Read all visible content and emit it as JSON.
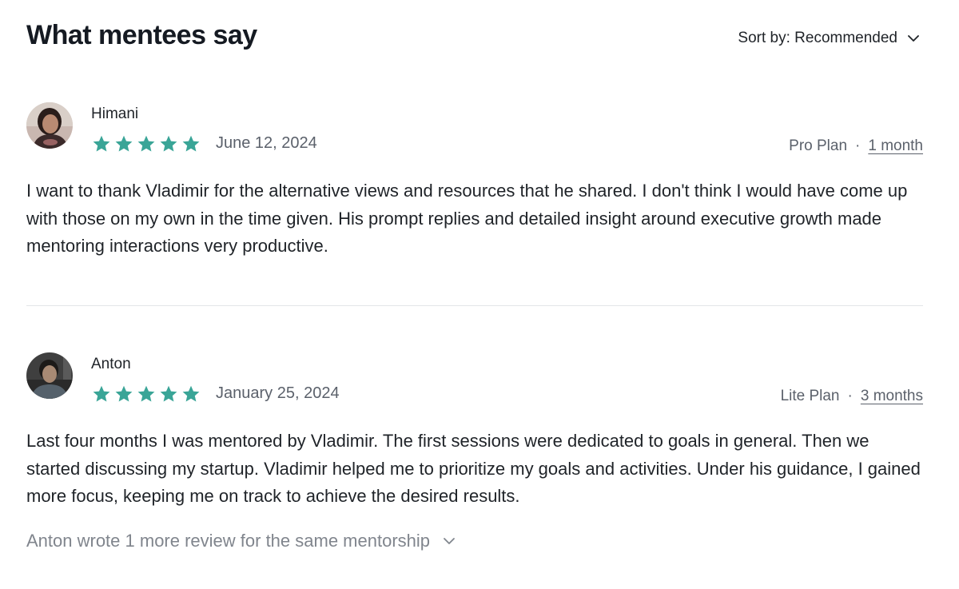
{
  "header": {
    "title": "What mentees say",
    "sort_label": "Sort by: Recommended"
  },
  "star_color": "#3aa597",
  "reviews": [
    {
      "name": "Himani",
      "rating": 5,
      "date": "June 12, 2024",
      "plan": "Pro Plan",
      "separator": "·",
      "duration": "1 month",
      "text": "I want to thank Vladimir for the alternative views and resources that he shared. I don't think I would have come up with those on my own in the time given. His prompt replies and detailed insight around executive growth made mentoring interactions very productive."
    },
    {
      "name": "Anton",
      "rating": 5,
      "date": "January 25, 2024",
      "plan": "Lite Plan",
      "separator": "·",
      "duration": "3 months",
      "text": "Last four months I was mentored by Vladimir. The first sessions were dedicated to goals in general. Then we started discussing my startup. Vladimir helped me to prioritize my goals and activities. Under his guidance, I gained more focus, keeping me on track to achieve the desired results."
    }
  ],
  "more_reviews_label": "Anton wrote 1 more review for the same mentorship"
}
